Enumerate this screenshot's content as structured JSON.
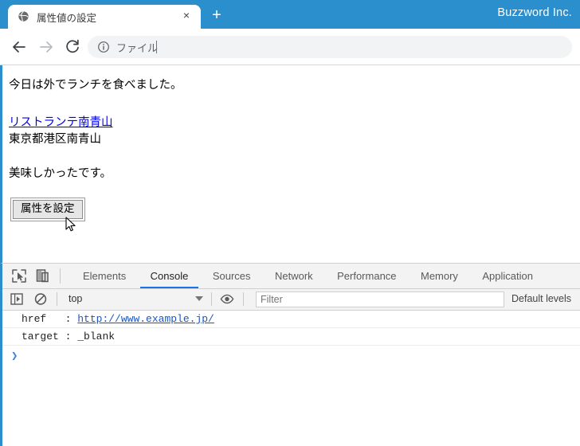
{
  "browser": {
    "brand": "Buzzword Inc.",
    "tab": {
      "title": "属性値の設定",
      "favicon": "globe-icon",
      "close": "×"
    },
    "new_tab": "+",
    "nav": {
      "back": "back-arrow-icon",
      "forward": "forward-arrow-icon",
      "reload": "reload-icon"
    },
    "omnibox": {
      "info_icon": "info-circle-icon",
      "value": "ファイル"
    }
  },
  "page": {
    "line1": "今日は外でランチを食べました。",
    "link": "リストランテ南青山",
    "address": "東京都港区南青山",
    "line2": "美味しかったです。",
    "button": "属性を設定"
  },
  "devtools": {
    "icons": {
      "inspect": "inspect-element-icon",
      "device": "device-toolbar-icon",
      "sidebar": "console-sidebar-icon",
      "clear": "clear-console-icon",
      "eye": "live-expression-eye-icon"
    },
    "tabs": [
      {
        "label": "Elements",
        "active": false
      },
      {
        "label": "Console",
        "active": true
      },
      {
        "label": "Sources",
        "active": false
      },
      {
        "label": "Network",
        "active": false
      },
      {
        "label": "Performance",
        "active": false
      },
      {
        "label": "Memory",
        "active": false
      },
      {
        "label": "Application",
        "active": false
      }
    ],
    "filter_bar": {
      "context": "top",
      "filter_placeholder": "Filter",
      "filter_value": "",
      "levels": "Default levels"
    },
    "console_rows": [
      {
        "key": "href   :",
        "value": "http://www.example.jp/",
        "is_link": true
      },
      {
        "key": "target :",
        "value": "_blank",
        "is_link": false
      }
    ],
    "prompt": "❯"
  },
  "colors": {
    "titlebar": "#2b8fce",
    "accent": "#1a73e8",
    "link": "#0000ee",
    "console_link": "#1a56c4"
  }
}
